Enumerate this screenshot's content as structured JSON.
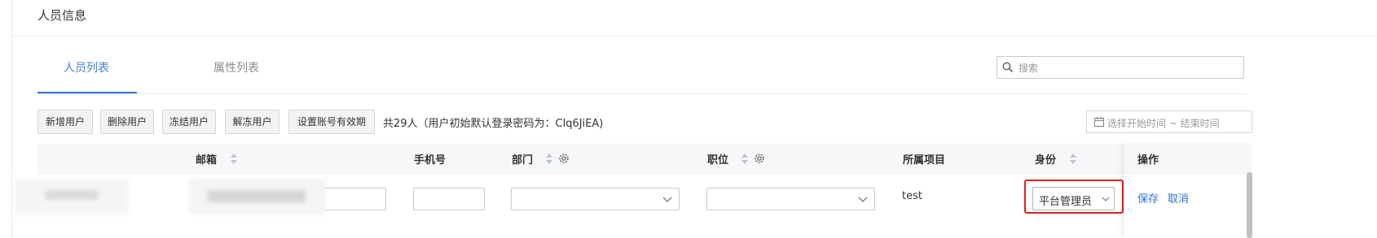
{
  "page": {
    "title": "人员信息"
  },
  "tabs": [
    {
      "label": "人员列表",
      "active": true
    },
    {
      "label": "属性列表",
      "active": false
    }
  ],
  "search": {
    "placeholder": "搜索",
    "icon": "search-icon"
  },
  "toolbar": {
    "buttons": [
      "新增用户",
      "删除用户",
      "冻结用户",
      "解冻用户",
      "设置账号有效期"
    ],
    "summary": "共29人（用户初始默认登录密码为：Clq6JiEA)"
  },
  "date_range": {
    "placeholder": "选择开始时间 ~ 结束时间",
    "icon": "calendar-icon"
  },
  "table": {
    "columns": {
      "email": "邮箱",
      "phone": "手机号",
      "department": "部门",
      "position": "职位",
      "project": "所属项目",
      "role": "身份",
      "actions": "操作"
    },
    "row": {
      "project": "test",
      "role": "平台管理员",
      "save": "保存",
      "cancel": "取消"
    }
  },
  "colors": {
    "accent": "#2f6fd9",
    "highlight": "#e02020",
    "header_bg": "#f6f7f9"
  }
}
